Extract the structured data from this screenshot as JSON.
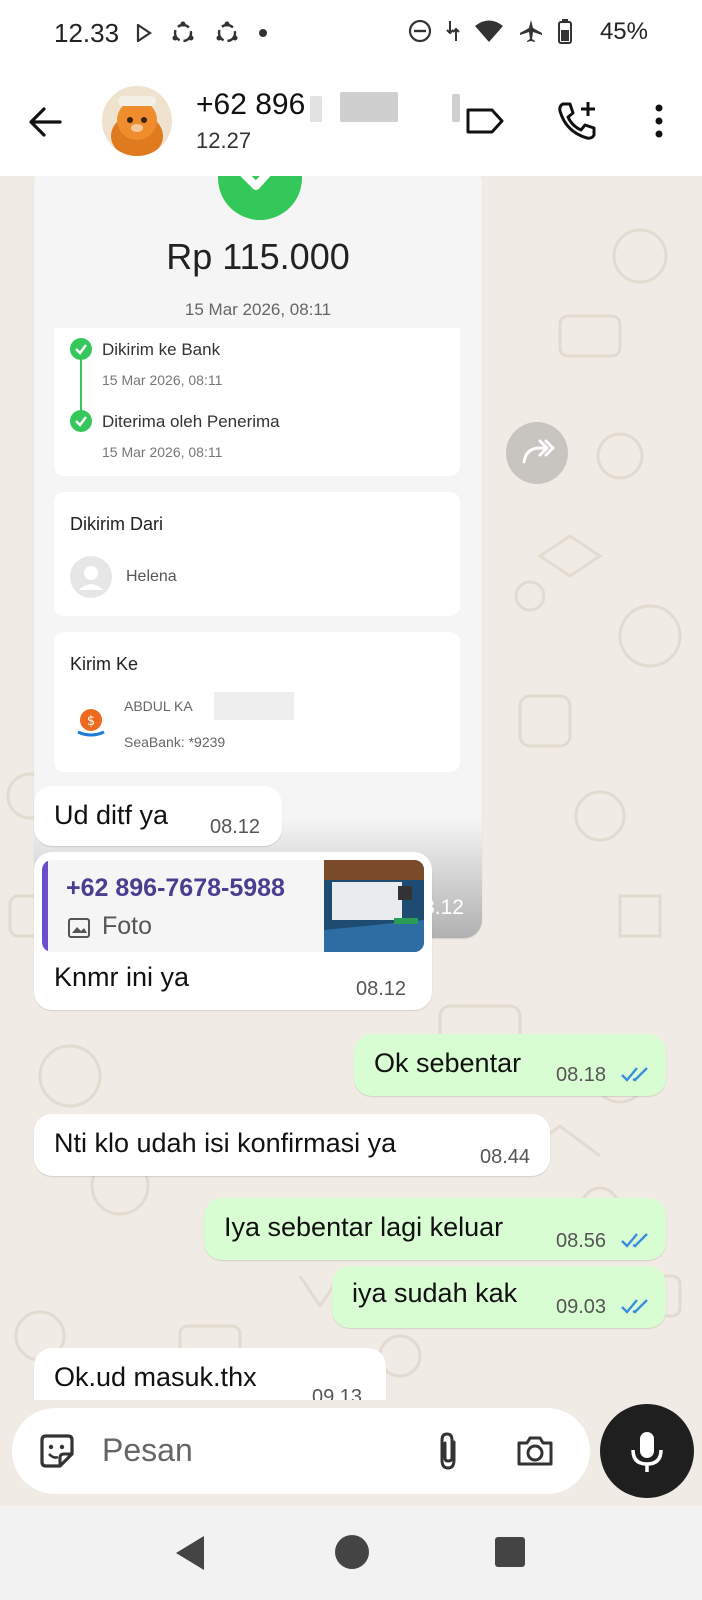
{
  "status_bar": {
    "time": "12.33",
    "battery": "45%",
    "icons_left": [
      "play-icon",
      "sync-icon",
      "sync-icon",
      "dot-icon"
    ],
    "icons_right": [
      "dnd-icon",
      "data-icon",
      "wifi-icon",
      "airplane-icon",
      "battery-icon"
    ]
  },
  "header": {
    "contact_name": "+62 896",
    "status": "12.27",
    "icons": [
      "back-arrow-icon",
      "label-icon",
      "add-call-icon",
      "more-vert-icon"
    ]
  },
  "chat": {
    "receipt": {
      "amount": "Rp 115.000",
      "date": "15 Mar 2026, 08:11",
      "steps": [
        {
          "title": "Dikirim ke Bank",
          "date": "15 Mar 2026, 08:11"
        },
        {
          "title": "Diterima oleh Penerima",
          "date": "15 Mar 2026, 08:11"
        }
      ],
      "sender_label": "Dikirim Dari",
      "sender_name": "Helena",
      "recipient_label": "Kirim Ke",
      "recipient_name": "ABDUL KA",
      "recipient_bank": "SeaBank: *9239",
      "time": "08.12"
    },
    "messages": [
      {
        "text": "Ud ditf ya",
        "time": "08.12",
        "dir": "in"
      },
      {
        "quote_name": "+62 896-7678-5988",
        "quote_type": "Foto",
        "text": "Knmr ini ya",
        "time": "08.12",
        "dir": "in"
      },
      {
        "text": "Ok sebentar",
        "time": "08.18",
        "dir": "out"
      },
      {
        "text": "Nti klo udah isi konfirmasi ya",
        "time": "08.44",
        "dir": "in"
      },
      {
        "text": "Iya sebentar lagi keluar",
        "time": "08.56",
        "dir": "out"
      },
      {
        "text": "iya sudah kak",
        "time": "09.03",
        "dir": "out"
      },
      {
        "text": "Ok.ud masuk.thx",
        "time": "09.13",
        "dir": "in"
      }
    ]
  },
  "composer": {
    "placeholder": "Pesan",
    "icons": [
      "sticker-icon",
      "attach-icon",
      "camera-icon",
      "mic-icon"
    ]
  },
  "colors": {
    "outgoing_bubble": "#d9fdd3",
    "incoming_bubble": "#ffffff",
    "read_ticks": "#3b8de0",
    "success_green": "#34c759",
    "chat_background": "#f0ebe4"
  }
}
